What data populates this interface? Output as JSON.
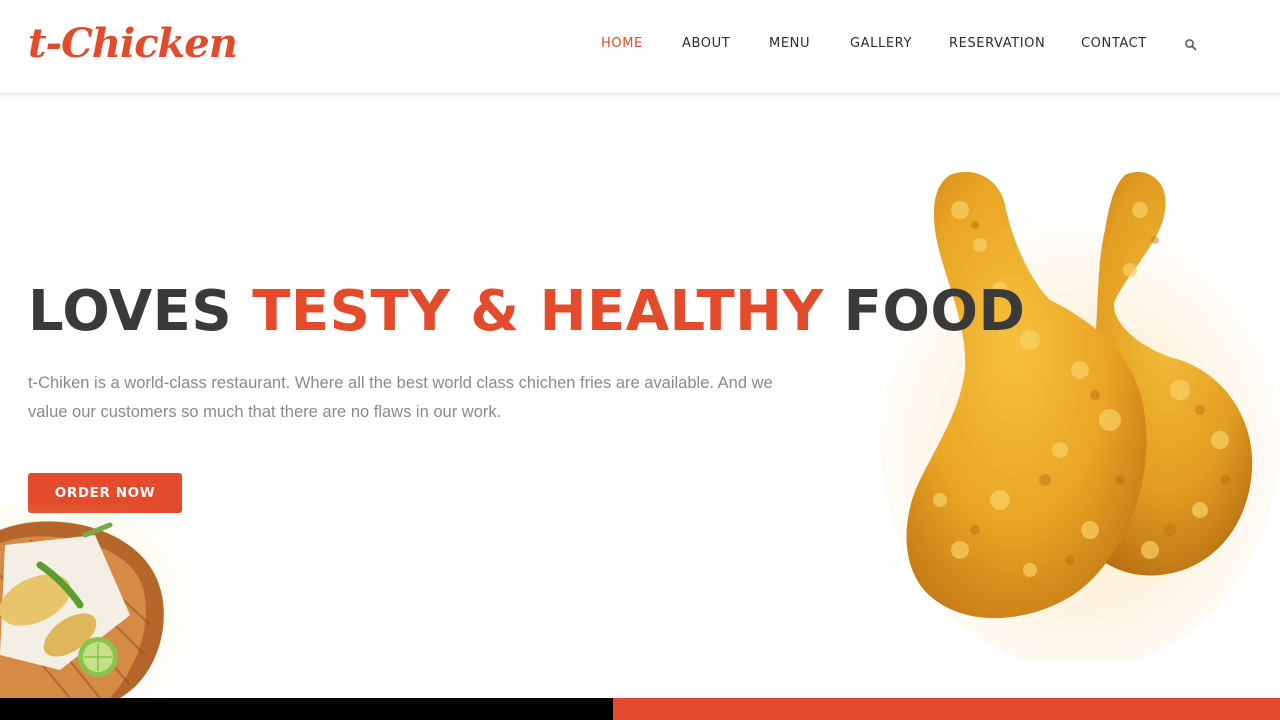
{
  "brand": {
    "logo_text": "t-Chicken",
    "accent_color": "#e24b2c"
  },
  "nav": {
    "items": [
      {
        "label": "HOME",
        "active": true
      },
      {
        "label": "ABOUT",
        "active": false
      },
      {
        "label": "MENU",
        "active": false
      },
      {
        "label": "GALLERY",
        "active": false
      },
      {
        "label": "RESERVATION",
        "active": false
      },
      {
        "label": "CONTACT",
        "active": false
      }
    ],
    "search_icon": "search-icon"
  },
  "hero": {
    "title_part1": "LOVES ",
    "title_accent": "TESTY & HEALTHY",
    "title_part2": " FOOD",
    "description": "t-Chiken is a world-class restaurant. Where all the best world class chichen fries are available. And we value our customers so much that there are no flaws in our work.",
    "cta_label": "ORDER NOW"
  },
  "images": {
    "main": "fried-chicken-drumsticks-image",
    "corner": "tempura-basket-image"
  },
  "colors": {
    "text_dark": "#3a3a3a",
    "text_muted": "#8a8a8a",
    "footer_dark": "#000000"
  }
}
